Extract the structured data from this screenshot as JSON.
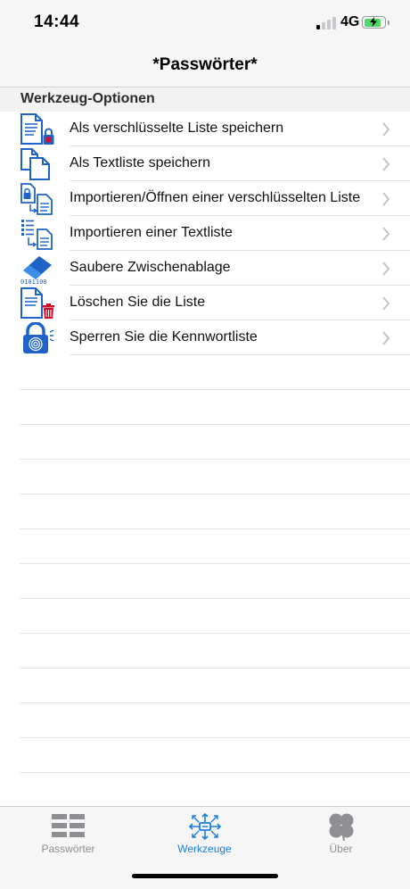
{
  "status_bar": {
    "time": "14:44",
    "network": "4G",
    "battery_level": 0.85,
    "battery_charging": true,
    "battery_color": "#4cd964"
  },
  "nav": {
    "title": "*Passwörter*"
  },
  "section": {
    "title": "Werkzeug-Optionen"
  },
  "menu": {
    "items": [
      {
        "label": "Als verschlüsselte Liste speichern",
        "icon": "encrypted-document-icon"
      },
      {
        "label": "Als Textliste speichern",
        "icon": "copy-document-icon"
      },
      {
        "label": "Importieren/Öffnen einer verschlüsselten Liste",
        "icon": "import-encrypted-icon"
      },
      {
        "label": "Importieren einer Textliste",
        "icon": "import-text-list-icon"
      },
      {
        "label": "Saubere Zwischenablage",
        "icon": "eraser-clipboard-icon"
      },
      {
        "label": "Löschen Sie die Liste",
        "icon": "delete-list-icon"
      },
      {
        "label": "Sperren Sie die Kennwortliste",
        "icon": "lock-fingerprint-icon"
      }
    ]
  },
  "eraser_caption": "0101100",
  "tabs": [
    {
      "label": "Passwörter",
      "icon": "list-grid-icon",
      "active": false
    },
    {
      "label": "Werkzeuge",
      "icon": "tools-network-icon",
      "active": true
    },
    {
      "label": "Über",
      "icon": "clover-icon",
      "active": false
    }
  ],
  "colors": {
    "accent": "#1a7ee0",
    "icon_blue": "#1f63c8",
    "inactive_tab": "#8e8e93",
    "danger": "#c8102e"
  }
}
